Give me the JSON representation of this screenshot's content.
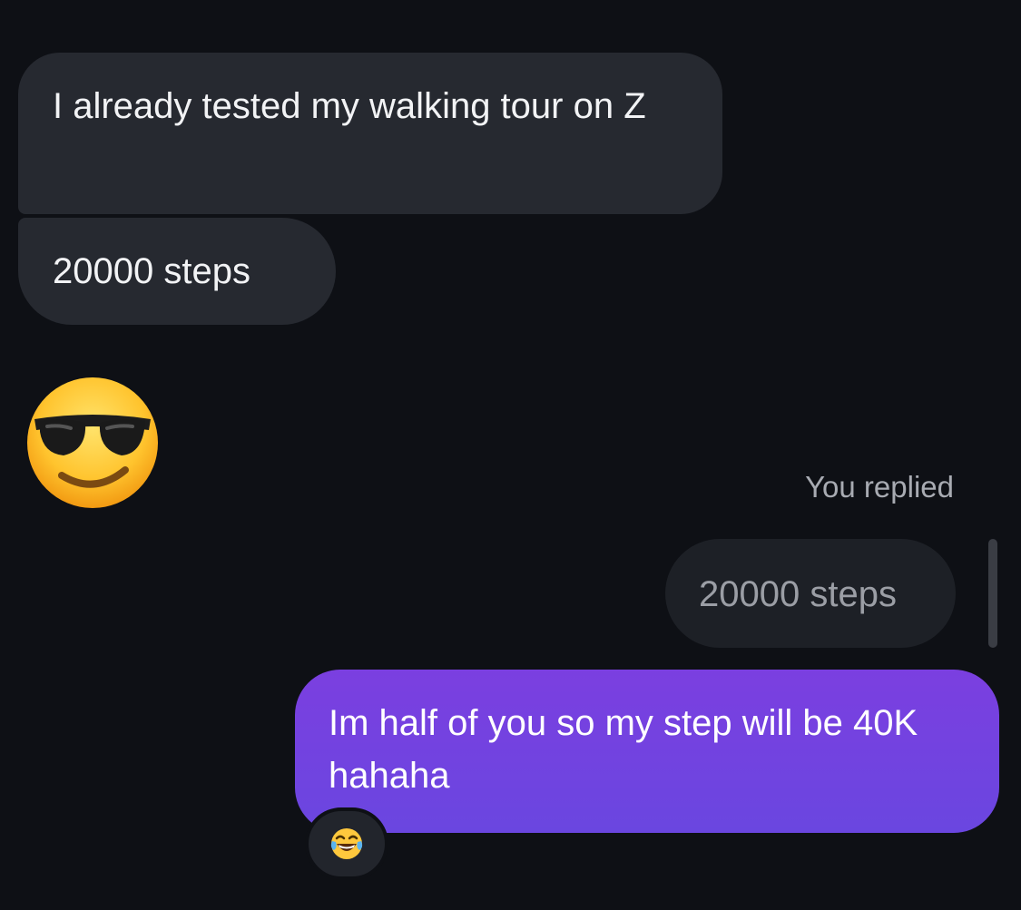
{
  "messages": {
    "incoming": [
      {
        "text": "I already tested my walking tour on Z"
      },
      {
        "text": "20000 steps"
      }
    ],
    "emoji_message": {
      "icon": "smiling-face-with-sunglasses-icon"
    },
    "reply": {
      "label": "You replied",
      "quoted_text": "20000 steps",
      "text": "Im half of you so my step will be 40K hahaha"
    },
    "reaction": {
      "icon": "face-with-tears-of-joy-icon"
    }
  },
  "colors": {
    "background": "#0e1015",
    "incoming_bubble": "#262930",
    "quoted_bubble": "#1d2026",
    "outgoing_gradient_top": "#7b3fe0",
    "outgoing_gradient_bottom": "#6a46e0"
  }
}
